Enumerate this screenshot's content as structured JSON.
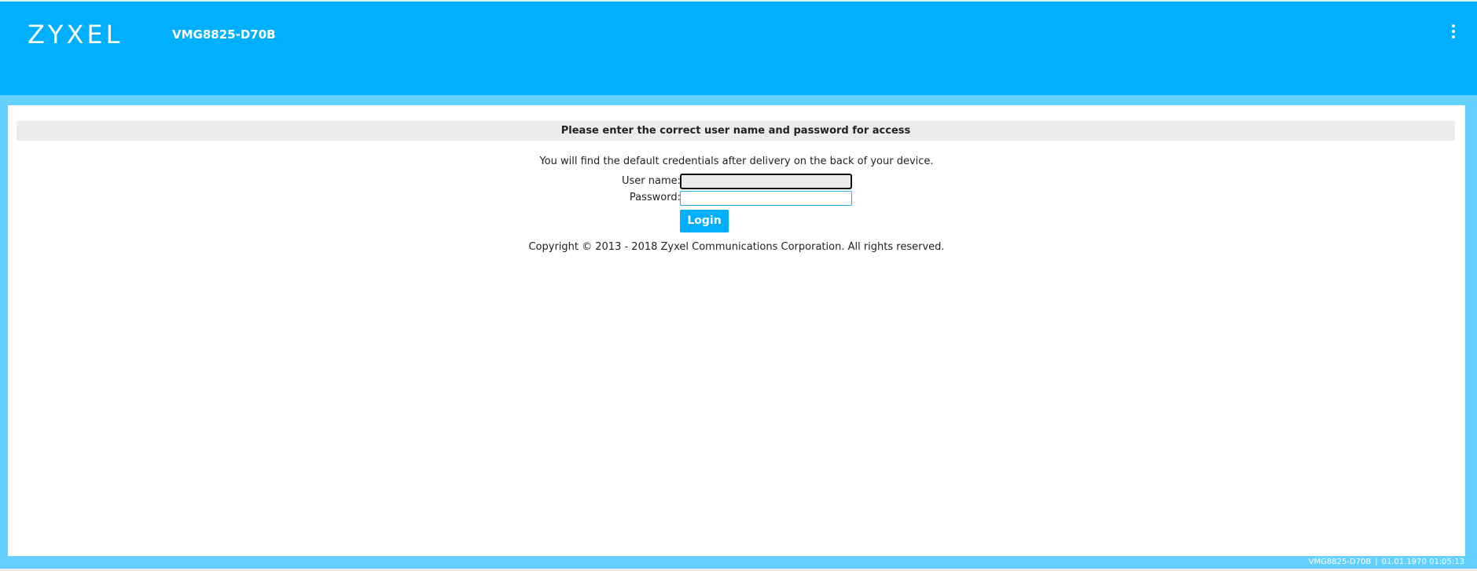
{
  "header": {
    "logo_text": "ZYXEL",
    "model": "VMG8825-D70B",
    "menu_icon": "more-vertical-icon"
  },
  "login": {
    "notice": "Please enter the correct user name and password for access",
    "hint": "You will find the default credentials after delivery on the back of your device.",
    "username_label": "User name:",
    "username_value": "",
    "password_label": "Password:",
    "password_value": "",
    "login_label": "Login"
  },
  "copyright": "Copyright © 2013 - 2018 Zyxel Communications Corporation. All rights reserved.",
  "footer": {
    "model": "VMG8825-D70B",
    "separator": "|",
    "datetime": "01.01.1970 01:05:13"
  },
  "colors": {
    "brand_blue": "#00b0ff",
    "frame_blue": "#63d1ff",
    "notice_bar": "#ececec"
  }
}
